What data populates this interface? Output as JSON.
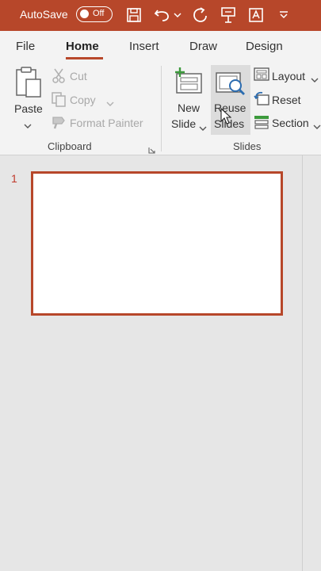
{
  "titlebar": {
    "autosave_label": "AutoSave",
    "toggle_state": "Off",
    "accent_color": "#b7472a",
    "icons": [
      "save-icon",
      "undo-icon",
      "undo-dropdown-icon",
      "redo-icon",
      "present-icon",
      "text-box-icon",
      "customize-toolbar-icon"
    ]
  },
  "tabs": [
    {
      "label": "File"
    },
    {
      "label": "Home",
      "active": true
    },
    {
      "label": "Insert"
    },
    {
      "label": "Draw"
    },
    {
      "label": "Design"
    }
  ],
  "ribbon": {
    "clipboard": {
      "paste_label": "Paste",
      "cut_label": "Cut",
      "copy_label": "Copy",
      "format_painter_label": "Format Painter",
      "group_label": "Clipboard"
    },
    "slides": {
      "new_slide_line1": "New",
      "new_slide_line2": "Slide",
      "reuse_line1": "Reuse",
      "reuse_line2": "Slides",
      "layout_label": "Layout",
      "reset_label": "Reset",
      "section_label": "Section",
      "group_label": "Slides"
    }
  },
  "thumbnails": [
    {
      "number": "1"
    }
  ]
}
